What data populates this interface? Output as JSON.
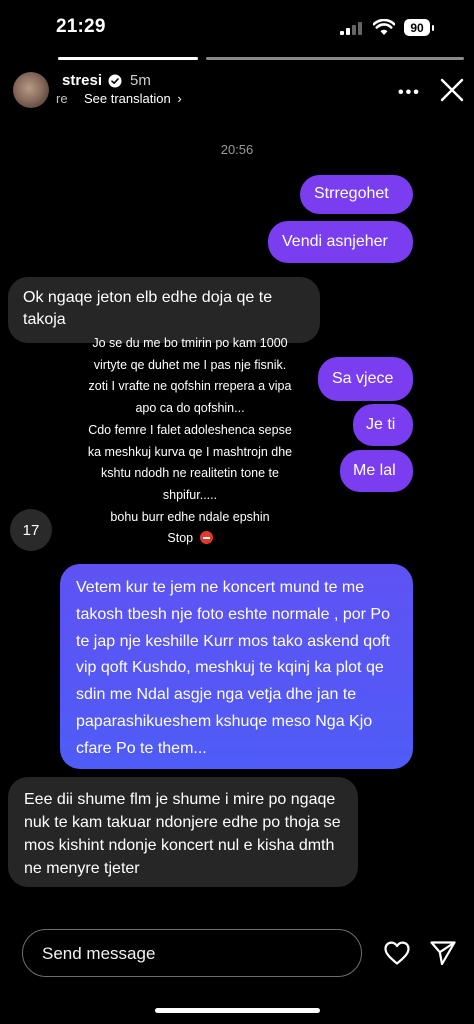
{
  "status_bar": {
    "time": "21:29",
    "battery": "90"
  },
  "header": {
    "username": "stresi",
    "time_ago": "5m",
    "see_translation": "See translation",
    "ghost_text": "re",
    "more": "•••"
  },
  "chat": {
    "timestamp": "20:56",
    "messages_sent_top": [
      "Strregohet",
      "Vendi asnjeher"
    ],
    "message_received_1": "Ok ngaqe jeton elb edhe doja qe te takoja",
    "messages_sent_mid": [
      "Sa vjece",
      "Je ti",
      "Me lal"
    ],
    "count_badge": "17",
    "message_sent_long": "Vetem kur te jem ne koncert mund te me takosh tbesh nje foto eshte normale , por Po te jap nje keshille Kurr mos tako askend qoft vip qoft Kushdo, meshkuj te kqinj ka plot qe sdin me Ndal asgje nga vetja dhe jan te paparashikueshem kshuqe meso Nga Kjo cfare Po te them...",
    "message_received_2": "Eee dii shume flm je shume i mire po ngaqe nuk te kam takuar ndonjere edhe po thoja se mos kishint ndonje koncert nul e kisha dmth ne menyre tjeter"
  },
  "overlay_text": [
    "Jo se du me bo tmirin po kam 1000",
    "virtyte qe duhet me I pas nje fisnik.",
    "zoti I vrafte ne qofshin rrepera a vipa",
    "apo ca do qofshin...",
    "Cdo femre I falet adoleshenca sepse",
    "ka meshkuj kurva qe I mashtrojn dhe",
    "kshtu ndodh ne realitetin tone te",
    "shpifur.....",
    "bohu burr edhe ndale epshin",
    "Stop"
  ],
  "composer": {
    "placeholder": "Send message"
  },
  "colors": {
    "sent_bubble": "#7a3ef0",
    "sent_gradient_end": "#5a54f6",
    "received_bubble": "#262626",
    "background": "#000000"
  },
  "icons": [
    "signal-icon",
    "wifi-icon",
    "battery-icon",
    "verified-icon",
    "chevron-right-icon",
    "more-icon",
    "close-icon",
    "heart-icon",
    "send-icon",
    "stop-emoji-icon"
  ]
}
